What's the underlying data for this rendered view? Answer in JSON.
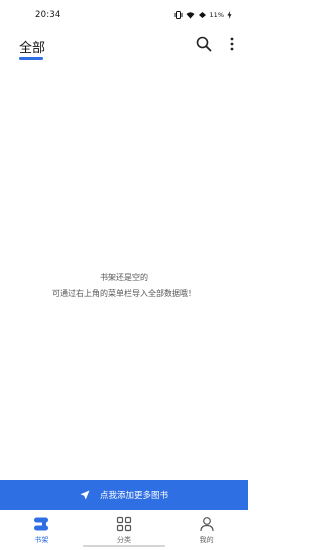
{
  "status": {
    "time": "20:34",
    "battery": "11%"
  },
  "header": {
    "tab_label": "全部",
    "search_icon": "search-icon",
    "more_icon": "more-vertical-icon"
  },
  "empty_state": {
    "title": "书架还是空的",
    "hint": "可通过右上角的菜单栏导入全部数据哦！"
  },
  "import_button": {
    "label": "点我添加更多图书",
    "icon": "send-arrow-icon"
  },
  "bottom_nav": {
    "items": [
      {
        "label": "书架",
        "icon": "bookshelf-icon"
      },
      {
        "label": "分类",
        "icon": "grid-icon"
      },
      {
        "label": "我的",
        "icon": "person-icon"
      }
    ]
  },
  "colors": {
    "accent": "#2f6fe4",
    "text_muted": "#555555"
  }
}
